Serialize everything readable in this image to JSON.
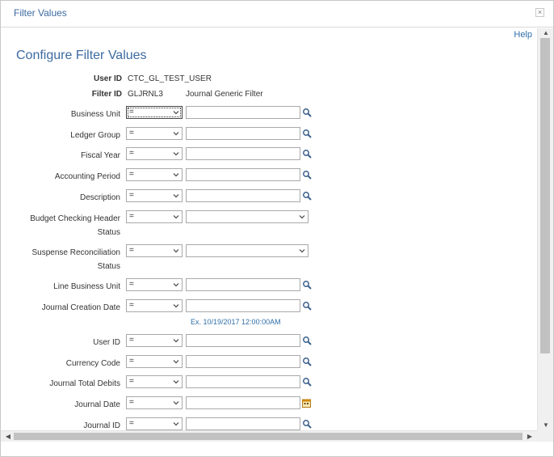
{
  "dialog": {
    "title": "Filter Values",
    "close_symbol": "×",
    "help_label": "Help"
  },
  "page": {
    "title": "Configure Filter Values",
    "user_id_label": "User ID",
    "user_id_value": "CTC_GL_TEST_USER",
    "filter_id_label": "Filter ID",
    "filter_id_value": "GLJRNL3",
    "filter_description": "Journal Generic Filter"
  },
  "filters": [
    {
      "label": "Business Unit",
      "operator": "=",
      "value": "",
      "control": "lookup"
    },
    {
      "label": "Ledger Group",
      "operator": "=",
      "value": "",
      "control": "lookup"
    },
    {
      "label": "Fiscal Year",
      "operator": "=",
      "value": "",
      "control": "lookup"
    },
    {
      "label": "Accounting Period",
      "operator": "=",
      "value": "",
      "control": "lookup"
    },
    {
      "label": "Description",
      "operator": "=",
      "value": "",
      "control": "lookup"
    },
    {
      "label_line1": "Budget Checking Header",
      "label_line2": "Status",
      "operator": "=",
      "value": "",
      "control": "dropdown"
    },
    {
      "label_line1": "Suspense Reconciliation",
      "label_line2": "Status",
      "operator": "=",
      "value": "",
      "control": "dropdown"
    },
    {
      "label": "Line Business Unit",
      "operator": "=",
      "value": "",
      "control": "lookup"
    },
    {
      "label": "Journal Creation Date",
      "operator": "=",
      "value": "",
      "control": "lookup",
      "hint": "Ex. 10/19/2017 12:00:00AM"
    },
    {
      "label": "User ID",
      "operator": "=",
      "value": "",
      "control": "lookup"
    },
    {
      "label": "Currency Code",
      "operator": "=",
      "value": "",
      "control": "lookup"
    },
    {
      "label": "Journal Total Debits",
      "operator": "=",
      "value": "",
      "control": "lookup"
    },
    {
      "label": "Journal Date",
      "operator": "=",
      "value": "",
      "control": "calendar"
    },
    {
      "label": "Journal ID",
      "operator": "=",
      "value": "",
      "control": "lookup"
    }
  ],
  "icons": {
    "lookup": "magnifier-icon",
    "calendar": "calendar-icon",
    "dropdown": "chevron-down-icon"
  },
  "colors": {
    "title_blue": "#3d6aa1",
    "link_blue": "#2e6ea8",
    "calendar_accent": "#d08a00"
  }
}
